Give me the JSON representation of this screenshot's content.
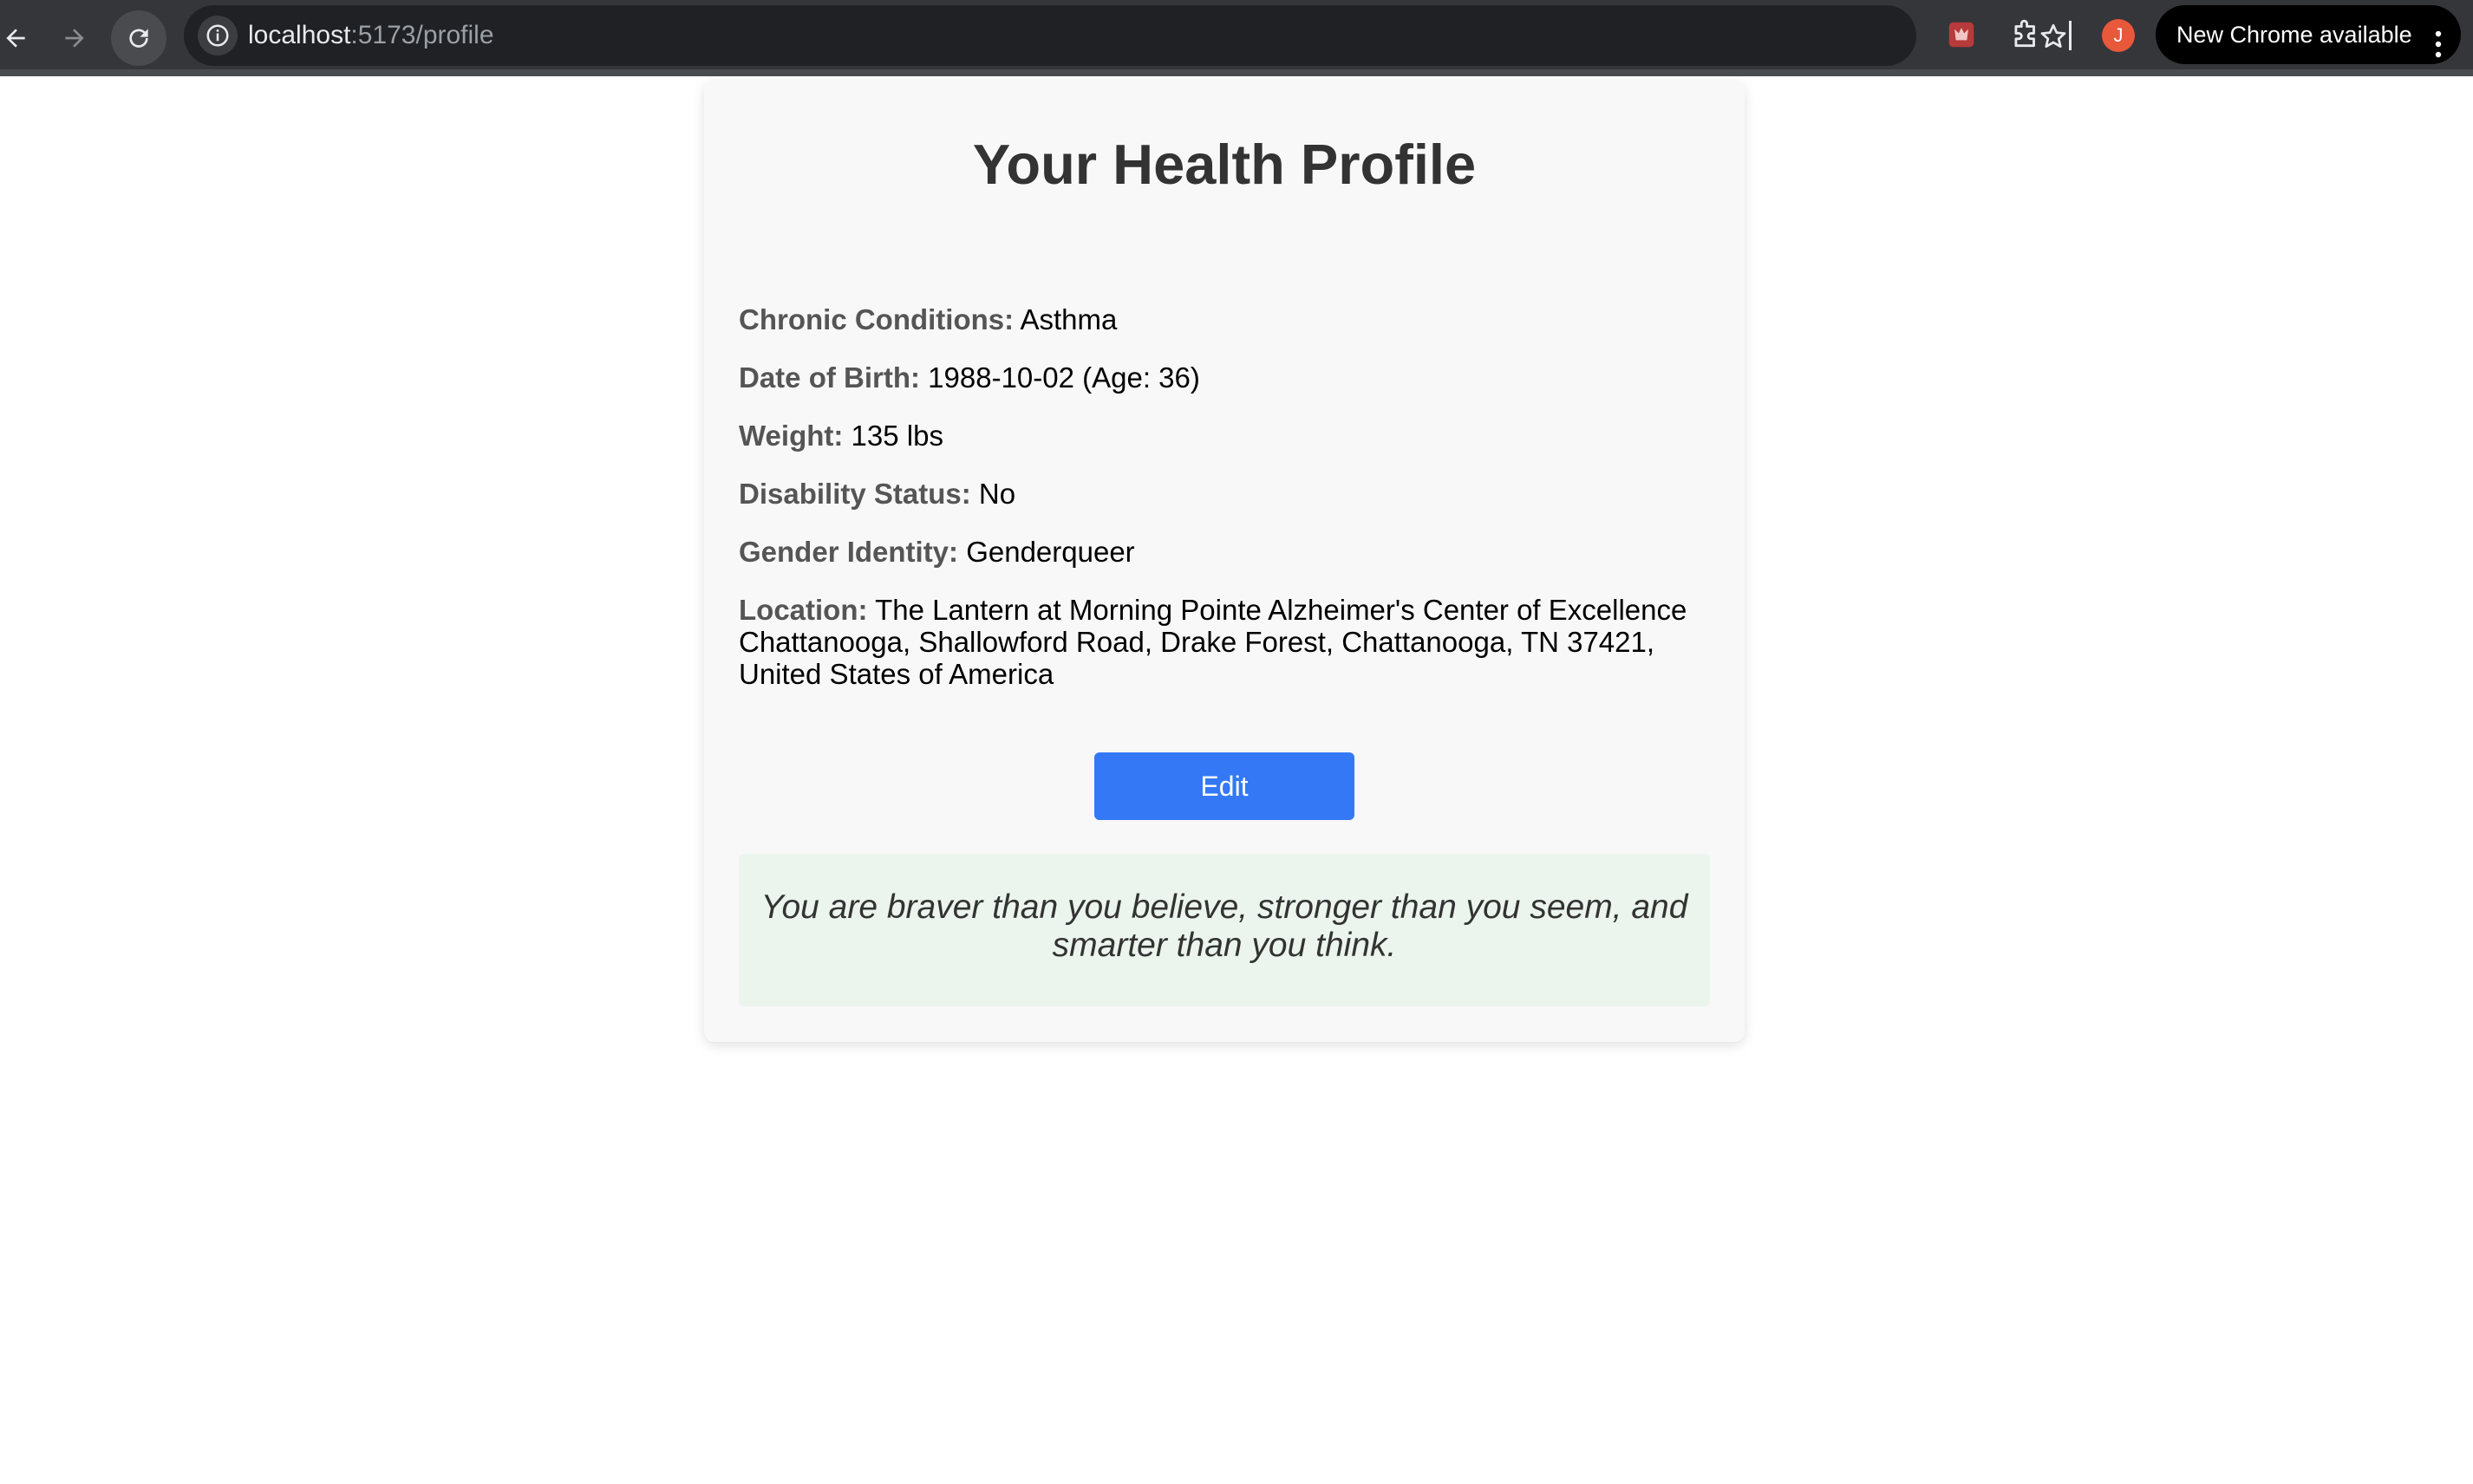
{
  "browser": {
    "url_host": "localhost",
    "url_path": ":5173/profile",
    "profile_initial": "J",
    "update_label": "New Chrome available",
    "colors": {
      "toolbar": "#35363a",
      "omnibox": "#202124",
      "avatar": "#e8583a"
    },
    "icons": [
      "back-arrow-icon",
      "forward-arrow-icon",
      "reload-icon",
      "info-icon",
      "star-icon",
      "extension-shield-icon",
      "puzzle-icon",
      "more-vert-icon"
    ]
  },
  "profile": {
    "title": "Your Health Profile",
    "fields": [
      {
        "label": "Chronic Conditions:",
        "value": "Asthma"
      },
      {
        "label": "Date of Birth:",
        "value": "1988-10-02 (Age: 36)"
      },
      {
        "label": "Weight:",
        "value": "135 lbs"
      },
      {
        "label": "Disability Status:",
        "value": "No"
      },
      {
        "label": "Gender Identity:",
        "value": "Genderqueer"
      },
      {
        "label": "Location:",
        "value": "The Lantern at Morning Pointe Alzheimer's Center of Excellence Chattanooga, Shallowford Road, Drake Forest, Chattanooga, TN 37421, United States of America"
      }
    ],
    "edit_label": "Edit",
    "quote": "You are braver than you believe, stronger than you seem, and smarter than you think.",
    "colors": {
      "button": "#3478f6",
      "quote_background": "#ebf5ed",
      "card": "#f8f8f8"
    }
  }
}
